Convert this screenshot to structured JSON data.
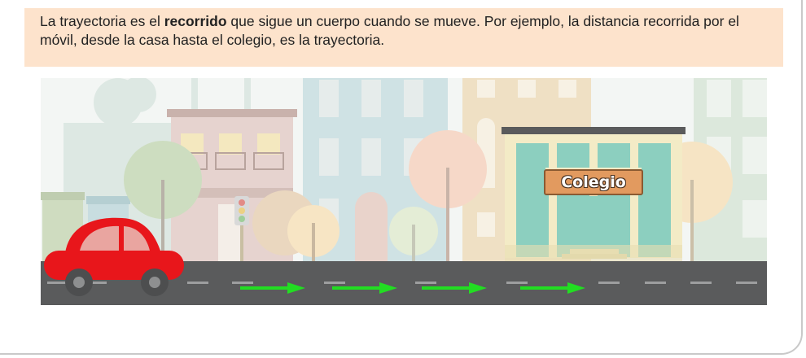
{
  "description": {
    "before": "La trayectoria es el ",
    "bold": "recorrido",
    "after": " que sigue un cuerpo cuando se mueve. Por ejemplo, la distancia recorrida por el móvil, desde la casa hasta el colegio, es la trayectoria."
  },
  "scene": {
    "sign_label": "Colegio",
    "arrow_color": "#22dd22",
    "car_color": "#e8161b",
    "road_color": "#5a5b5c"
  }
}
